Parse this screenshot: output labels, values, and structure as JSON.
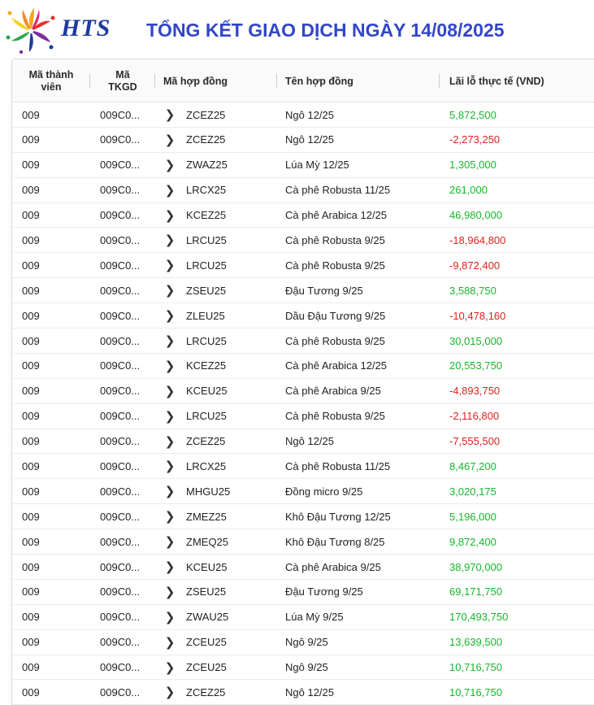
{
  "header": {
    "brand": "HTS",
    "title": "TỔNG KẾT GIAO DỊCH NGÀY 14/08/2025"
  },
  "columns": {
    "member_line1": "Mã thành",
    "member_line2": "viên",
    "account_line1": "Mã",
    "account_line2": "TKGD",
    "contract_code": "Mã hợp đồng",
    "contract_name": "Tên hợp đồng",
    "pnl": "Lãi lỗ thực tế (VND)"
  },
  "rows": [
    {
      "member": "009",
      "account": "009C0...",
      "code": "ZCEZ25",
      "name": "Ngô 12/25",
      "pnl": "5,872,500",
      "sign": "pos"
    },
    {
      "member": "009",
      "account": "009C0...",
      "code": "ZCEZ25",
      "name": "Ngô 12/25",
      "pnl": "-2,273,250",
      "sign": "neg"
    },
    {
      "member": "009",
      "account": "009C0...",
      "code": "ZWAZ25",
      "name": "Lúa Mỳ 12/25",
      "pnl": "1,305,000",
      "sign": "pos"
    },
    {
      "member": "009",
      "account": "009C0...",
      "code": "LRCX25",
      "name": "Cà phê Robusta 11/25",
      "pnl": "261,000",
      "sign": "pos"
    },
    {
      "member": "009",
      "account": "009C0...",
      "code": "KCEZ25",
      "name": "Cà phê Arabica 12/25",
      "pnl": "46,980,000",
      "sign": "pos"
    },
    {
      "member": "009",
      "account": "009C0...",
      "code": "LRCU25",
      "name": "Cà phê Robusta 9/25",
      "pnl": "-18,964,800",
      "sign": "neg"
    },
    {
      "member": "009",
      "account": "009C0...",
      "code": "LRCU25",
      "name": "Cà phê Robusta 9/25",
      "pnl": "-9,872,400",
      "sign": "neg"
    },
    {
      "member": "009",
      "account": "009C0...",
      "code": "ZSEU25",
      "name": "Đậu Tương 9/25",
      "pnl": "3,588,750",
      "sign": "pos"
    },
    {
      "member": "009",
      "account": "009C0...",
      "code": "ZLEU25",
      "name": "Dầu Đậu Tương 9/25",
      "pnl": "-10,478,160",
      "sign": "neg"
    },
    {
      "member": "009",
      "account": "009C0...",
      "code": "LRCU25",
      "name": "Cà phê Robusta 9/25",
      "pnl": "30,015,000",
      "sign": "pos"
    },
    {
      "member": "009",
      "account": "009C0...",
      "code": "KCEZ25",
      "name": "Cà phê Arabica 12/25",
      "pnl": "20,553,750",
      "sign": "pos"
    },
    {
      "member": "009",
      "account": "009C0...",
      "code": "KCEU25",
      "name": "Cà phê Arabica 9/25",
      "pnl": "-4,893,750",
      "sign": "neg"
    },
    {
      "member": "009",
      "account": "009C0...",
      "code": "LRCU25",
      "name": "Cà phê Robusta 9/25",
      "pnl": "-2,116,800",
      "sign": "neg"
    },
    {
      "member": "009",
      "account": "009C0...",
      "code": "ZCEZ25",
      "name": "Ngô 12/25",
      "pnl": "-7,555,500",
      "sign": "neg"
    },
    {
      "member": "009",
      "account": "009C0...",
      "code": "LRCX25",
      "name": "Cà phê Robusta 11/25",
      "pnl": "8,467,200",
      "sign": "pos"
    },
    {
      "member": "009",
      "account": "009C0...",
      "code": "MHGU25",
      "name": "Đồng micro 9/25",
      "pnl": "3,020,175",
      "sign": "pos"
    },
    {
      "member": "009",
      "account": "009C0...",
      "code": "ZMEZ25",
      "name": "Khô Đậu Tương 12/25",
      "pnl": "5,196,000",
      "sign": "pos"
    },
    {
      "member": "009",
      "account": "009C0...",
      "code": "ZMEQ25",
      "name": "Khô Đậu Tương 8/25",
      "pnl": "9,872,400",
      "sign": "pos"
    },
    {
      "member": "009",
      "account": "009C0...",
      "code": "KCEU25",
      "name": "Cà phê Arabica 9/25",
      "pnl": "38,970,000",
      "sign": "pos"
    },
    {
      "member": "009",
      "account": "009C0...",
      "code": "ZSEU25",
      "name": "Đậu Tương 9/25",
      "pnl": "69,171,750",
      "sign": "pos"
    },
    {
      "member": "009",
      "account": "009C0...",
      "code": "ZWAU25",
      "name": "Lúa Mỳ 9/25",
      "pnl": "170,493,750",
      "sign": "pos"
    },
    {
      "member": "009",
      "account": "009C0...",
      "code": "ZCEU25",
      "name": "Ngô 9/25",
      "pnl": "13,639,500",
      "sign": "pos"
    },
    {
      "member": "009",
      "account": "009C0...",
      "code": "ZCEU25",
      "name": "Ngô 9/25",
      "pnl": "10,716,750",
      "sign": "pos"
    },
    {
      "member": "009",
      "account": "009C0...",
      "code": "ZCEZ25",
      "name": "Ngô 12/25",
      "pnl": "10,716,750",
      "sign": "pos"
    }
  ],
  "icons": {
    "row_expand": "chevron-right-icon",
    "logo": "hts-flower-logo-icon"
  },
  "colors": {
    "title": "#3246c8",
    "brand": "#1f3a9e",
    "profit": "#17b62a",
    "loss": "#e0201c"
  }
}
